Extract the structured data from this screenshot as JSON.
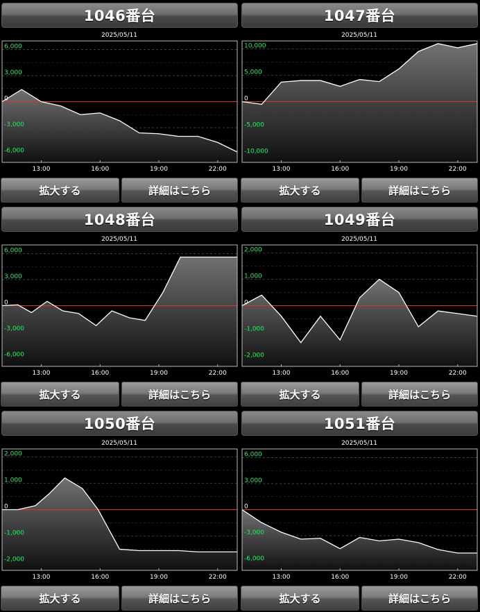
{
  "buttons": {
    "zoom": "拡大する",
    "detail": "詳細はこちら"
  },
  "colors": {
    "axis_label": "#22ee66",
    "zero_line": "#e03030",
    "line": "#ffffff",
    "fill_top": "#777777",
    "fill_bottom": "#111111",
    "grid": "#555555"
  },
  "chart_data": [
    {
      "type": "area",
      "title": "1046番台",
      "subtitle": "2025/05/11",
      "ylim": [
        -7000,
        7000
      ],
      "y_ticks": [
        6000,
        3000,
        0,
        -3000,
        -6000
      ],
      "y_tick_labels": [
        "6,000",
        "3,000",
        "0",
        "-3,000",
        "-6,000"
      ],
      "xlim": [
        11,
        23
      ],
      "x_ticks": [
        13,
        16,
        19,
        22
      ],
      "x_tick_labels": [
        "13:00",
        "16:00",
        "19:00",
        "22:00"
      ],
      "x": [
        11,
        12,
        13,
        14,
        15,
        16,
        17,
        18,
        19,
        20,
        21,
        22,
        23
      ],
      "values": [
        0,
        1400,
        0,
        -500,
        -1500,
        -1300,
        -2200,
        -3600,
        -3700,
        -4000,
        -4000,
        -4700,
        -5800,
        -4500
      ]
    },
    {
      "type": "area",
      "title": "1047番台",
      "subtitle": "2025/05/11",
      "ylim": [
        -11500,
        11500
      ],
      "y_ticks": [
        10000,
        5000,
        0,
        -5000,
        -10000
      ],
      "y_tick_labels": [
        "10,000",
        "5,000",
        "0",
        "-5,000",
        "-10,000"
      ],
      "xlim": [
        11,
        23
      ],
      "x_ticks": [
        13,
        16,
        19,
        22
      ],
      "x_tick_labels": [
        "13:00",
        "16:00",
        "19:00",
        "22:00"
      ],
      "x": [
        11,
        12,
        13,
        14,
        15,
        16,
        17,
        18,
        19,
        20,
        21,
        22,
        23
      ],
      "values": [
        0,
        -500,
        3700,
        4000,
        4000,
        2900,
        4200,
        3800,
        6200,
        9500,
        11000,
        10200,
        11000
      ]
    },
    {
      "type": "area",
      "title": "1048番台",
      "subtitle": "2025/05/11",
      "ylim": [
        -7000,
        7000
      ],
      "y_ticks": [
        6000,
        3000,
        0,
        -3000,
        -6000
      ],
      "y_tick_labels": [
        "6,000",
        "3,000",
        "0",
        "-3,000",
        "-6,000"
      ],
      "xlim": [
        11,
        23
      ],
      "x_ticks": [
        13,
        16,
        19,
        22
      ],
      "x_tick_labels": [
        "13:00",
        "16:00",
        "19:00",
        "22:00"
      ],
      "x": [
        11,
        11.8,
        12.5,
        13.3,
        14.1,
        14.9,
        15.8,
        16.6,
        17.5,
        18.3,
        19.2,
        20.1,
        21,
        23
      ],
      "values": [
        0,
        100,
        -800,
        500,
        -600,
        -900,
        -2300,
        -600,
        -1400,
        -1700,
        1500,
        5600,
        5600,
        5600
      ]
    },
    {
      "type": "area",
      "title": "1049番台",
      "subtitle": "2025/05/11",
      "ylim": [
        -2300,
        2300
      ],
      "y_ticks": [
        2000,
        1000,
        0,
        -1000,
        -2000
      ],
      "y_tick_labels": [
        "2,000",
        "1,000",
        "0",
        "-1,000",
        "-2,000"
      ],
      "xlim": [
        11,
        23
      ],
      "x_ticks": [
        13,
        16,
        19,
        22
      ],
      "x_tick_labels": [
        "13:00",
        "16:00",
        "19:00",
        "22:00"
      ],
      "x": [
        11,
        12,
        13,
        14,
        15,
        16,
        17,
        18,
        19,
        20,
        21,
        22,
        23
      ],
      "values": [
        0,
        400,
        -400,
        -1400,
        -400,
        -1300,
        300,
        1000,
        500,
        -800,
        -200,
        -300,
        -400,
        -400
      ]
    },
    {
      "type": "area",
      "title": "1050番台",
      "subtitle": "2025/05/11",
      "ylim": [
        -2300,
        2300
      ],
      "y_ticks": [
        2000,
        1000,
        0,
        -1000,
        -2000
      ],
      "y_tick_labels": [
        "2,000",
        "1,000",
        "0",
        "-1,000",
        "-2,000"
      ],
      "xlim": [
        11,
        23
      ],
      "x_ticks": [
        13,
        16,
        19,
        22
      ],
      "x_tick_labels": [
        "13:00",
        "16:00",
        "19:00",
        "22:00"
      ],
      "x": [
        11,
        11.8,
        12.7,
        13.4,
        14.2,
        15.1,
        15.9,
        17,
        18,
        19,
        20,
        21,
        22,
        23
      ],
      "values": [
        0,
        0,
        150,
        600,
        1200,
        800,
        0,
        -1500,
        -1550,
        -1550,
        -1550,
        -1600,
        -1600,
        -1600
      ]
    },
    {
      "type": "area",
      "title": "1051番台",
      "subtitle": "2025/05/11",
      "ylim": [
        -7000,
        7000
      ],
      "y_ticks": [
        6000,
        3000,
        0,
        -3000,
        -6000
      ],
      "y_tick_labels": [
        "6,000",
        "3,000",
        "0",
        "-3,000",
        "-6,000"
      ],
      "xlim": [
        11,
        23
      ],
      "x_ticks": [
        13,
        16,
        19,
        22
      ],
      "x_tick_labels": [
        "13:00",
        "16:00",
        "19:00",
        "22:00"
      ],
      "x": [
        11,
        12,
        13,
        14,
        15,
        16,
        17,
        18,
        19,
        20,
        21,
        22,
        23
      ],
      "values": [
        0,
        -1500,
        -2600,
        -3400,
        -3300,
        -4500,
        -3200,
        -3600,
        -3400,
        -3800,
        -4600,
        -5000,
        -5000
      ]
    }
  ]
}
